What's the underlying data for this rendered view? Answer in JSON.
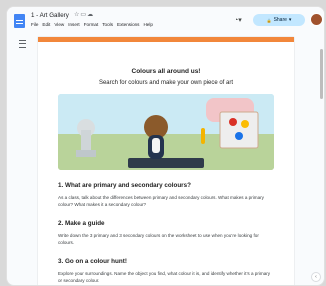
{
  "header": {
    "title": "1 - Art Gallery",
    "title_icons": [
      "star-icon",
      "folder-icon",
      "cloud-icon"
    ],
    "menus": [
      "File",
      "Edit",
      "View",
      "Insert",
      "Format",
      "Tools",
      "Extensions",
      "Help"
    ],
    "share_label": "Share",
    "brand_color": "#4285f4"
  },
  "doc": {
    "accent_color": "#f2873b",
    "title": "Colours all around us!",
    "subtitle": "Search for colours and make your own piece of art",
    "sections": [
      {
        "heading": "1. What are primary and secondary colours?",
        "text": "As a class, talk about the differences between primary and secondary colours. What makes a primary colour? What makes it a secondary colour?"
      },
      {
        "heading": "2. Make a guide",
        "text": "Write down the 3 primary and 3 secondary colours on the worksheet to use when you’re looking for colours."
      },
      {
        "heading": "3. Go on a colour hunt!",
        "text": "Explore your surroundings. Name the object you find, what colour it is, and identify whether it’s a primary or secondary colour."
      }
    ]
  }
}
